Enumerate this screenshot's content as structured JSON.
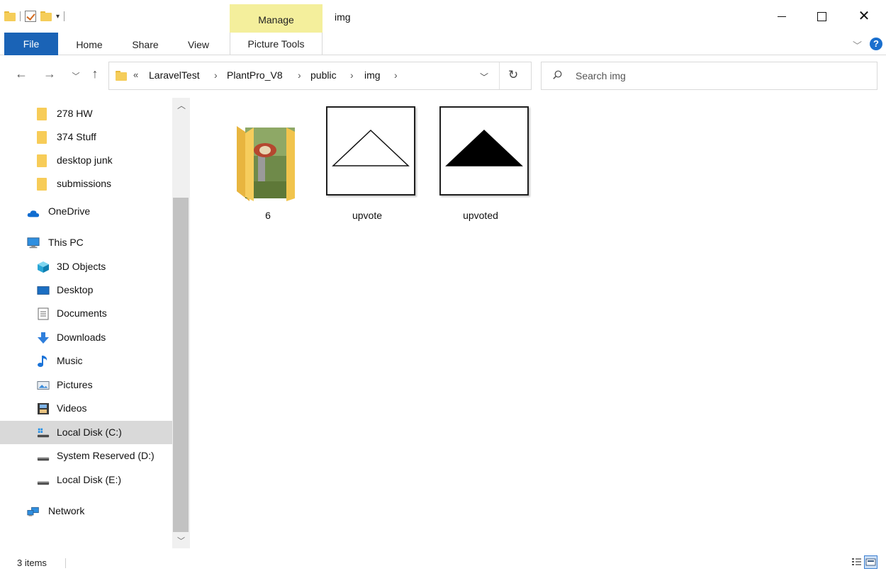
{
  "window": {
    "title": "img",
    "context_tab": "Manage"
  },
  "ribbon": {
    "tabs": [
      {
        "label": "File"
      },
      {
        "label": "Home"
      },
      {
        "label": "Share"
      },
      {
        "label": "View"
      },
      {
        "label": "Picture Tools"
      }
    ],
    "help_label": "?"
  },
  "address": {
    "overflow": "«",
    "breadcrumbs": [
      "LaravelTest",
      "PlantPro_V8",
      "public",
      "img"
    ],
    "separator": "›"
  },
  "search": {
    "placeholder": "Search img"
  },
  "nav_pane": {
    "items": [
      {
        "label": "278 HW",
        "icon": "folder-icon"
      },
      {
        "label": "374 Stuff",
        "icon": "folder-icon"
      },
      {
        "label": "desktop junk",
        "icon": "folder-icon"
      },
      {
        "label": "submissions",
        "icon": "folder-icon"
      },
      {
        "label": "OneDrive",
        "icon": "cloud-icon"
      },
      {
        "label": "This PC",
        "icon": "computer-icon"
      },
      {
        "label": "3D Objects",
        "icon": "cube-icon"
      },
      {
        "label": "Desktop",
        "icon": "desktop-icon"
      },
      {
        "label": "Documents",
        "icon": "document-icon"
      },
      {
        "label": "Downloads",
        "icon": "download-arrow-icon"
      },
      {
        "label": "Music",
        "icon": "music-note-icon"
      },
      {
        "label": "Pictures",
        "icon": "pictures-icon"
      },
      {
        "label": "Videos",
        "icon": "film-icon"
      },
      {
        "label": "Local Disk (C:)",
        "icon": "windows-drive-icon",
        "selected": true
      },
      {
        "label": "System Reserved (D:)",
        "icon": "drive-icon"
      },
      {
        "label": "Local Disk (E:)",
        "icon": "drive-icon"
      },
      {
        "label": "Network",
        "icon": "network-icon"
      }
    ]
  },
  "files": [
    {
      "name": "6",
      "type": "folder",
      "icon": "folder-with-photo-icon"
    },
    {
      "name": "upvote",
      "type": "image",
      "icon": "outline-triangle-icon"
    },
    {
      "name": "upvoted",
      "type": "image",
      "icon": "filled-triangle-icon"
    }
  ],
  "status": {
    "item_count": "3 items"
  },
  "colors": {
    "file_tab": "#1a63b6",
    "manage_tab": "#f4ef9c",
    "selection": "#d9d9d9",
    "folder": "#f7cc58"
  }
}
